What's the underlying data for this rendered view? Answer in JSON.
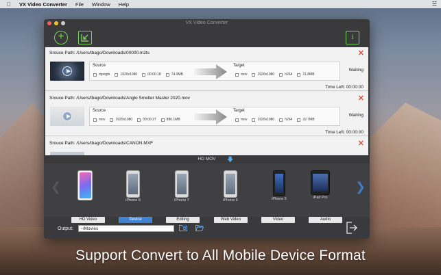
{
  "menubar": {
    "app_name": "VX Video Converter",
    "items": [
      "File",
      "Window",
      "Help"
    ]
  },
  "window": {
    "title": "VX Video Converter"
  },
  "tasks": [
    {
      "source_path": "Srouce Path:  /Users/tbago/Downloads/00000.m2ts",
      "source_label": "Source",
      "target_label": "Target",
      "source": {
        "format": "mpegts",
        "resolution": "1920x1080",
        "duration": "00:00:18",
        "size": "74.0MB"
      },
      "target": {
        "format": "mov",
        "resolution": "1920x1080",
        "codec": "h264",
        "size": "21.8MB"
      },
      "status": "Waiting",
      "time_left": "Time Left:   00:00:00"
    },
    {
      "source_path": "Srouce Path:  /Users/tbago/Downloads/Anglo Smelter Master 2020.mov",
      "source_label": "Source",
      "target_label": "Target",
      "source": {
        "format": "mov",
        "resolution": "1920x1080",
        "duration": "00:00:27",
        "size": "880.1MB"
      },
      "target": {
        "format": "mov",
        "resolution": "1920x1080",
        "codec": "h264",
        "size": "32.7MB"
      },
      "status": "Waiting",
      "time_left": "Time Left:   00:00:00"
    },
    {
      "source_path": "Srouce Path:  /Users/tbago/Downloads/CANON.MXF"
    }
  ],
  "format_bar": {
    "label": "HD MOV"
  },
  "devices": [
    {
      "name": "",
      "icon": "iphone-x-icon"
    },
    {
      "name": "iPhone 8",
      "icon": "iphone-8-icon"
    },
    {
      "name": "iPhone 7",
      "icon": "iphone-7-icon"
    },
    {
      "name": "iPhone 6",
      "icon": "iphone-6-icon"
    },
    {
      "name": "iPhone 5",
      "icon": "iphone-5-icon"
    },
    {
      "name": "iPad Pro",
      "icon": "ipad-pro-icon"
    }
  ],
  "tabs": [
    "HD Video",
    "Device",
    "Editing",
    "Web Video",
    "Video",
    "Audio"
  ],
  "active_tab": "Device",
  "output": {
    "label": "Output:",
    "path": "~/Movies"
  },
  "caption": "Support Convert to All Mobile Device Format",
  "colors": {
    "accent": "#7ad35f",
    "tab_active": "#3f83d4",
    "delete": "#e05040"
  }
}
